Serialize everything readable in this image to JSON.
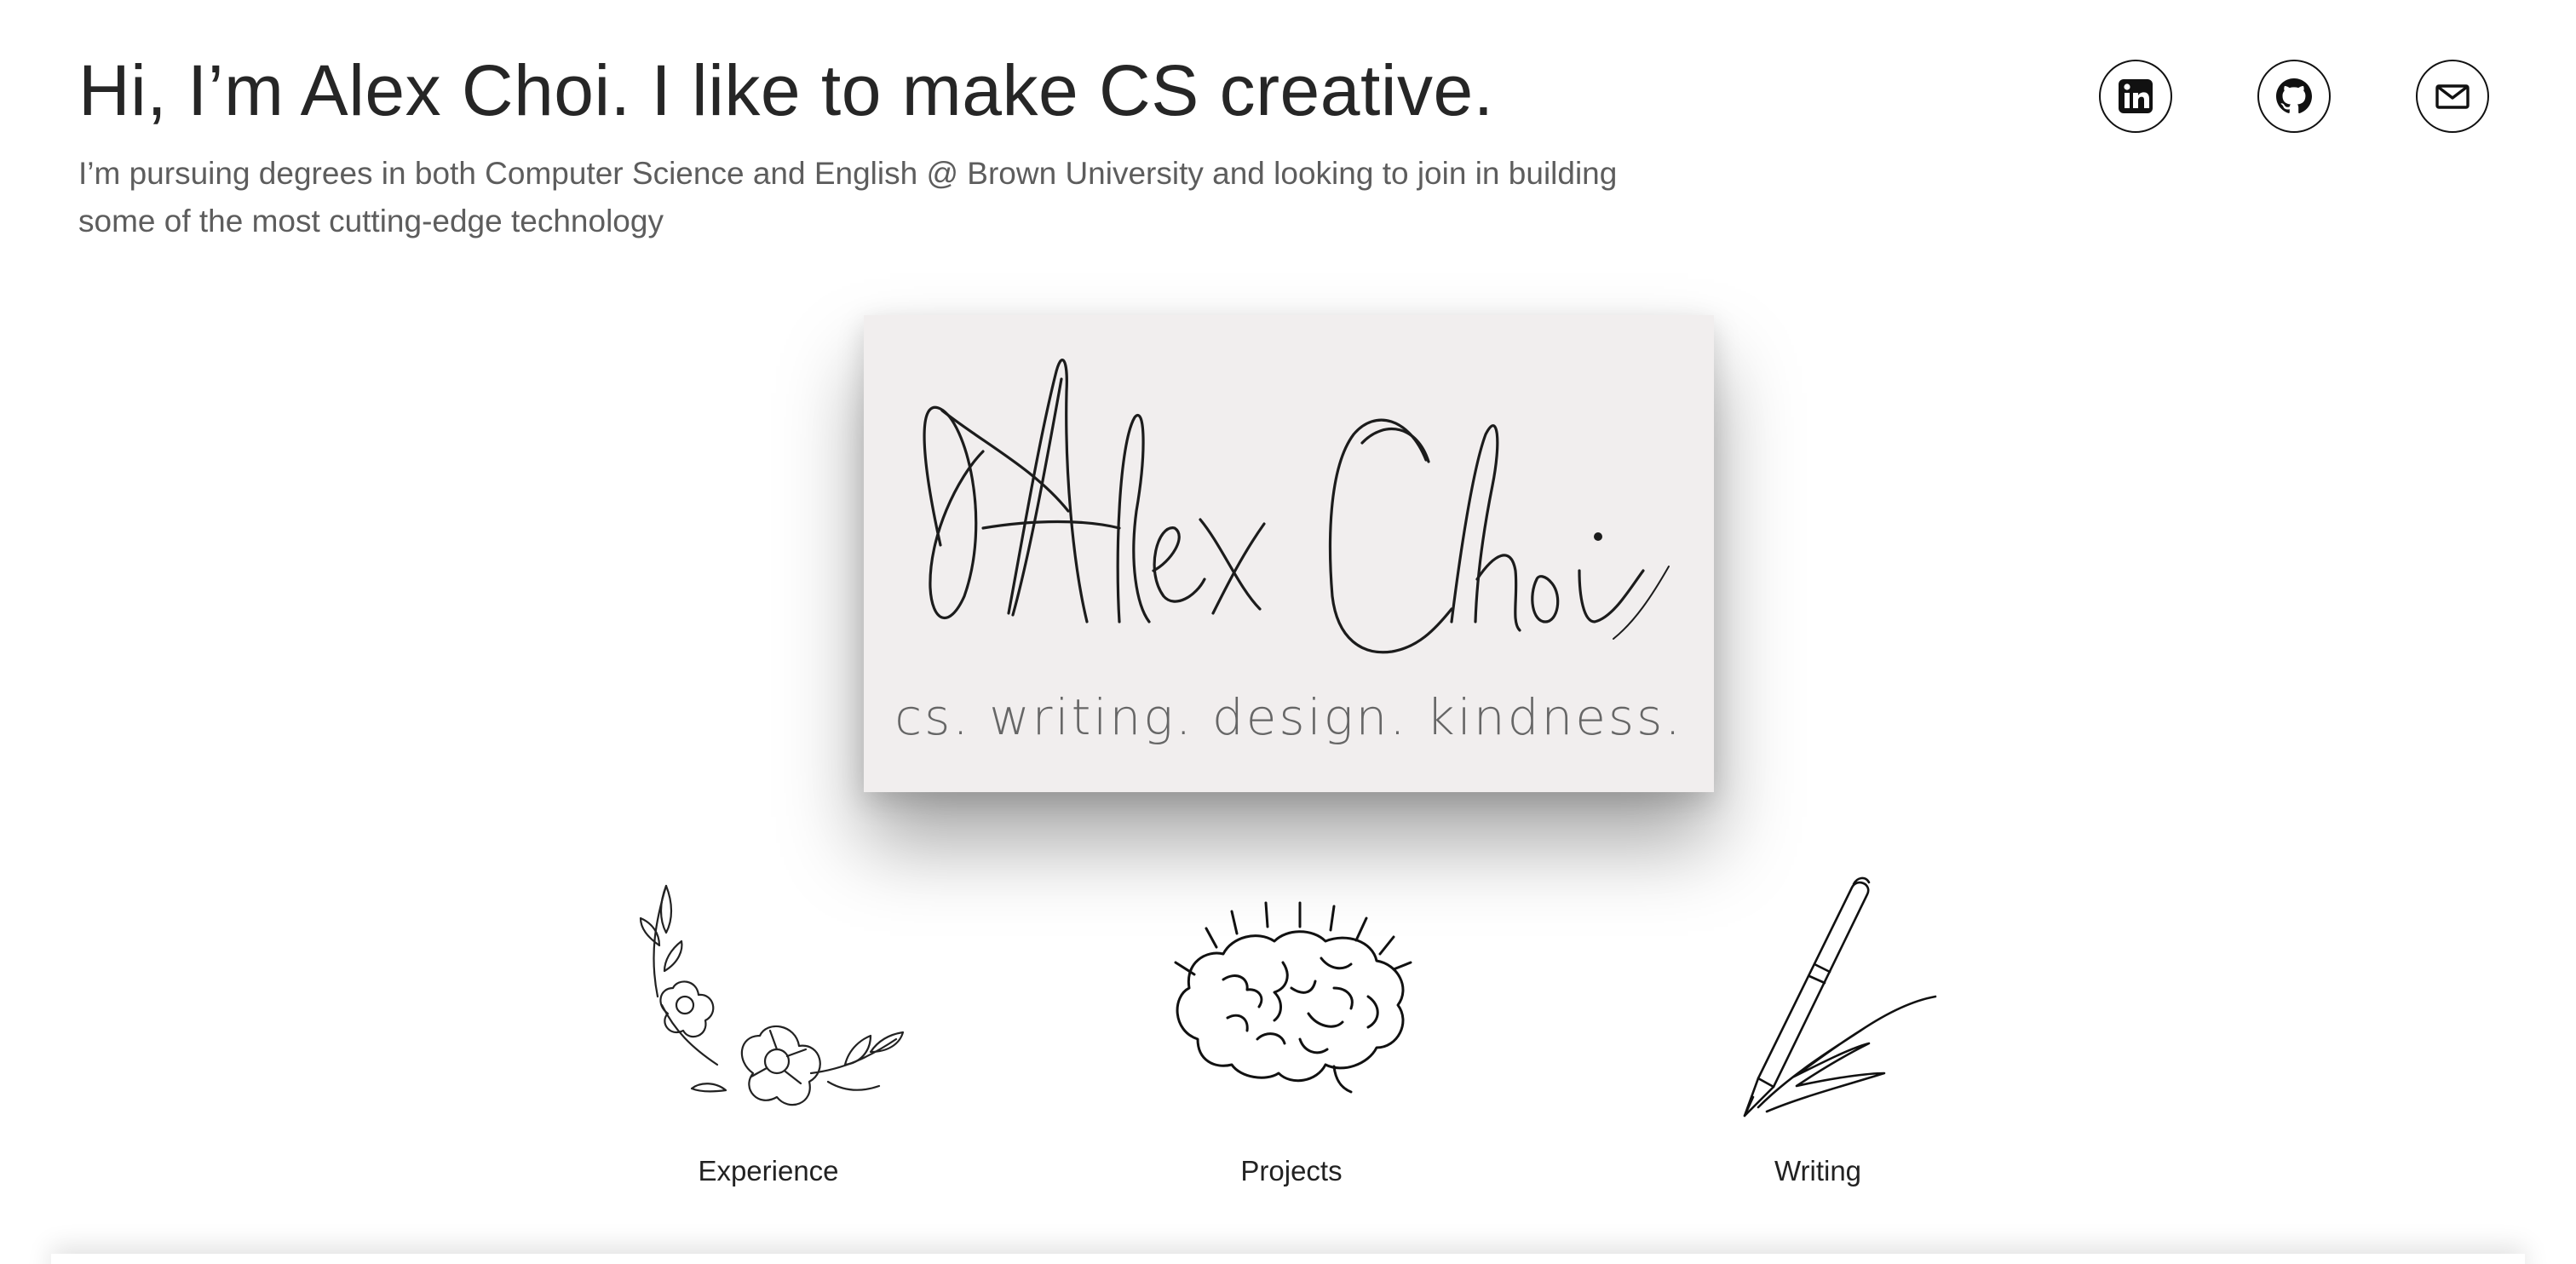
{
  "header": {
    "headline": "Hi, I’m Alex Choi. I like to make CS creative.",
    "subtitle": "I’m pursuing degrees in both Computer Science and English @ Brown University and looking to join in building some of the most cutting-edge technology"
  },
  "social": [
    {
      "name": "linkedin-icon"
    },
    {
      "name": "github-icon"
    },
    {
      "name": "mail-icon"
    }
  ],
  "hero": {
    "signature": "Alex Choi",
    "tagline": "cs. writing. design. kindness."
  },
  "nav": {
    "experience_label": "Experience",
    "projects_label": "Projects",
    "writing_label": "Writing"
  },
  "colors": {
    "text": "#262626",
    "subtext": "#5d5d5d",
    "hero_bg": "#f1eeee"
  }
}
